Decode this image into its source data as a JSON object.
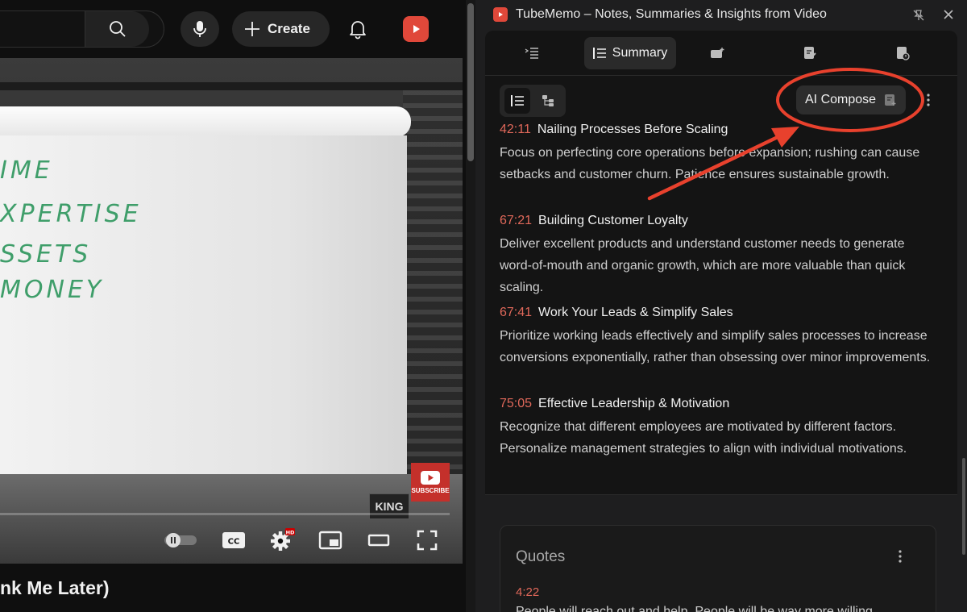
{
  "youtube": {
    "create_label": "Create",
    "video_title_fragment": "nk Me Later)",
    "handwriting": [
      "IME",
      "XPERTISE",
      "SSETS",
      "MONEY"
    ],
    "subscribe_badge": "SUBSCRIBE",
    "watermark": "KING",
    "hd_badge": "HD",
    "cc_label": "CC"
  },
  "panel": {
    "app_title": "TubeMemo – Notes, Summaries & Insights from Video",
    "tabs": [
      {
        "label": ""
      },
      {
        "label": "Summary"
      },
      {
        "label": ""
      },
      {
        "label": ""
      },
      {
        "label": ""
      }
    ],
    "ai_compose_label": "AI Compose",
    "sections": [
      {
        "timestamp": "42:11",
        "title": "Nailing Processes Before Scaling",
        "body": "Focus on perfecting core operations before expansion; rushing can cause setbacks and customer churn. Patience ensures sustainable growth."
      },
      {
        "timestamp": "67:21",
        "title": "Building Customer Loyalty",
        "body": "Deliver excellent products and understand customer needs to generate word-of-mouth and organic growth, which are more valuable than quick scaling."
      },
      {
        "timestamp": "67:41",
        "title": "Work Your Leads & Simplify Sales",
        "body": "Prioritize working leads effectively and simplify sales processes to increase conversions exponentially, rather than obsessing over minor improvements."
      },
      {
        "timestamp": "75:05",
        "title": "Effective Leadership & Motivation",
        "body": "Recognize that different employees are motivated by different factors. Personalize management strategies to align with individual motivations."
      }
    ],
    "quotes": {
      "title": "Quotes",
      "items": [
        {
          "timestamp": "4:22",
          "text": "People will reach out and help. People will be way more willing"
        }
      ]
    }
  },
  "colors": {
    "accent_timestamp": "#e0685a",
    "annotation": "#e8412d",
    "brand_red": "#e0483a"
  }
}
